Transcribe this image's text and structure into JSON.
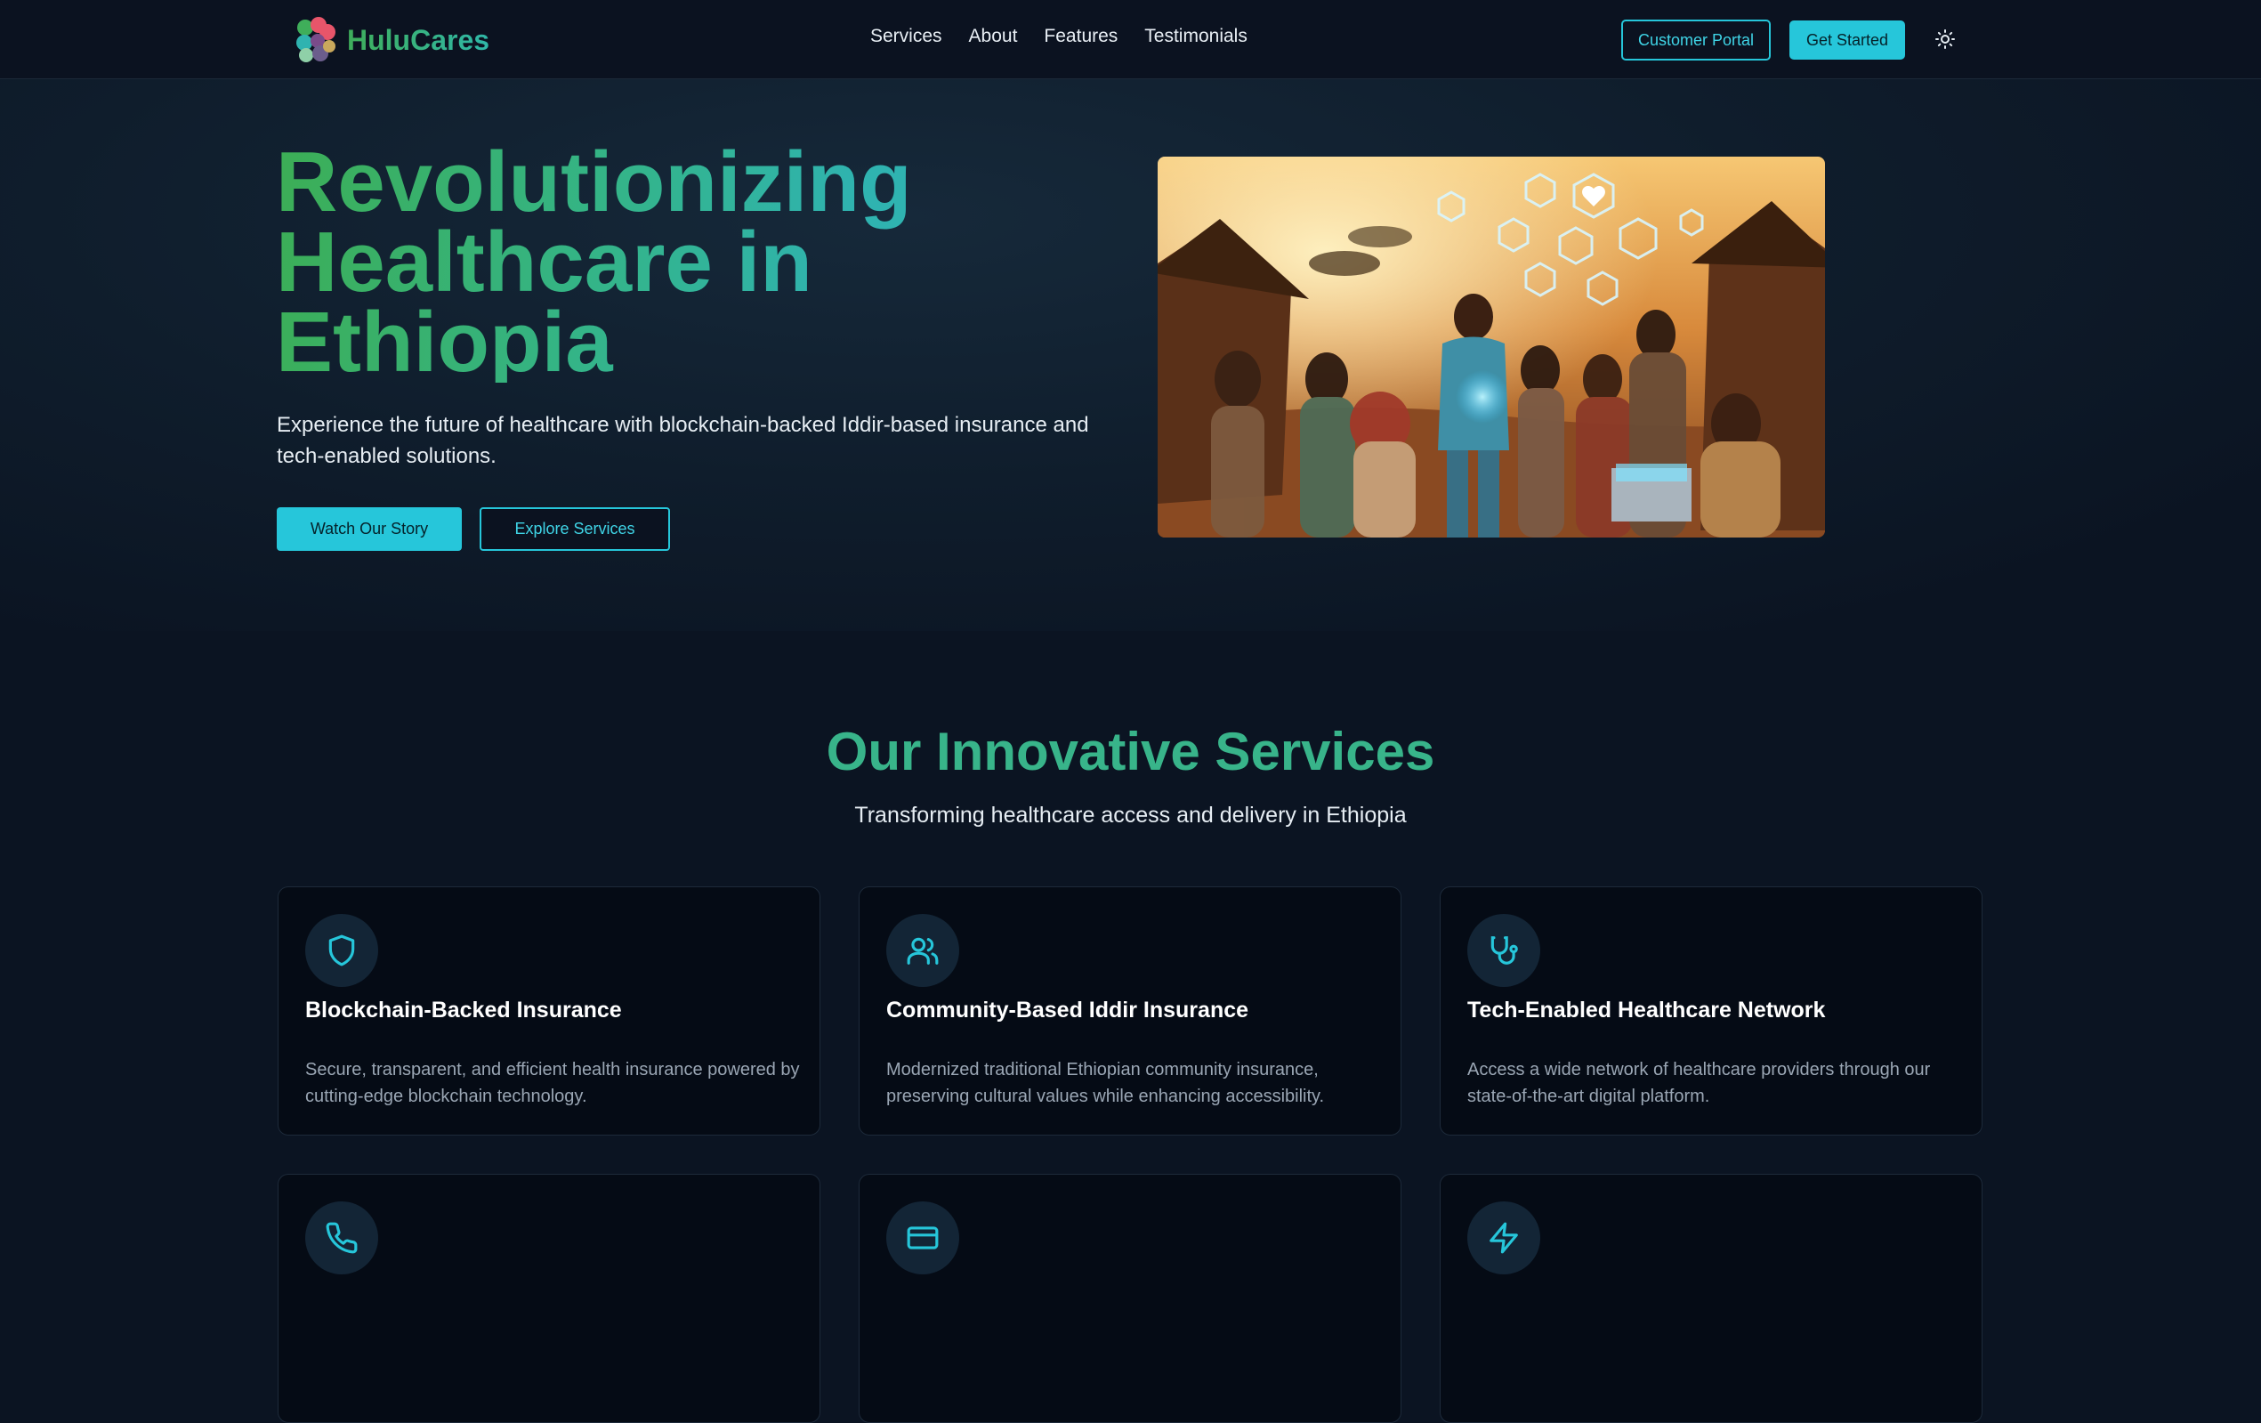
{
  "header": {
    "brand": "HuluCares",
    "nav": [
      "Services",
      "About",
      "Features",
      "Testimonials"
    ],
    "portal_label": "Customer Portal",
    "get_started_label": "Get Started",
    "theme_icon": "sun-icon"
  },
  "hero": {
    "title": "Revolutionizing Healthcare in Ethiopia",
    "subtitle": "Experience the future of healthcare with blockchain-backed Iddir-based insurance and tech-enabled solutions.",
    "watch_label": "Watch Our Story",
    "explore_label": "Explore Services"
  },
  "services": {
    "title": "Our Innovative Services",
    "subtitle": "Transforming healthcare access and delivery in Ethiopia",
    "cards": [
      {
        "icon": "shield-icon",
        "title": "Blockchain-Backed Insurance",
        "desc": "Secure, transparent, and efficient health insurance powered by cutting-edge blockchain technology."
      },
      {
        "icon": "users-icon",
        "title": "Community-Based Iddir Insurance",
        "desc": "Modernized traditional Ethiopian community insurance, preserving cultural values while enhancing accessibility."
      },
      {
        "icon": "stethoscope-icon",
        "title": "Tech-Enabled Healthcare Network",
        "desc": "Access a wide network of healthcare providers through our state-of-the-art digital platform."
      },
      {
        "icon": "phone-icon",
        "title": "",
        "desc": ""
      },
      {
        "icon": "credit-card-icon",
        "title": "",
        "desc": ""
      },
      {
        "icon": "zap-icon",
        "title": "",
        "desc": ""
      }
    ]
  },
  "colors": {
    "accent": "#26c6da",
    "brand_green": "#3cae55",
    "background": "#0b1422",
    "card_bg": "#050b15"
  }
}
